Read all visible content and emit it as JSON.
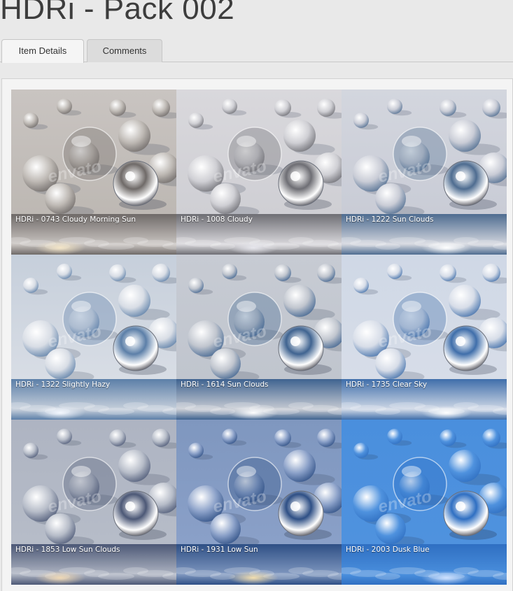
{
  "page": {
    "title": "HDRi - Pack 002"
  },
  "tabs": [
    {
      "label": "Item Details",
      "active": true
    },
    {
      "label": "Comments",
      "active": false
    }
  ],
  "preview": {
    "watermark": "envato",
    "tiles": [
      {
        "caption": "HDRi - 0743 Cloudy Morning Sun",
        "bg": "#c9c4c1",
        "floor": "#bdb8b3",
        "sky": "#6f6a68",
        "glow": "#f4e6c8"
      },
      {
        "caption": "HDRi - 1008 Cloudy",
        "bg": "#d9d8dc",
        "floor": "#cfcfd4",
        "sky": "#6e6e74",
        "glow": "#e8e8ee"
      },
      {
        "caption": "HDRi - 1222 Sun Clouds",
        "bg": "#d3d6de",
        "floor": "#c9ccd6",
        "sky": "#4e6c90",
        "glow": "#ffffff"
      },
      {
        "caption": "HDRi - 1322 Slightly Hazy",
        "bg": "#c6cfdb",
        "floor": "#d8dde5",
        "sky": "#5c7fa8",
        "glow": "#f4f8ff"
      },
      {
        "caption": "HDRi - 1614 Sun Clouds",
        "bg": "#c7cbd3",
        "floor": "#c0c5ce",
        "sky": "#3f6390",
        "glow": "#ffffff"
      },
      {
        "caption": "HDRi - 1735 Clear Sky",
        "bg": "#cfd8e6",
        "floor": "#d7dde8",
        "sky": "#3f6eaa",
        "glow": "#ffffff"
      },
      {
        "caption": "HDRi - 1853 Low Sun Clouds",
        "bg": "#aeb4c2",
        "floor": "#b6bcc8",
        "sky": "#4c5876",
        "glow": "#f0d9b6"
      },
      {
        "caption": "HDRi - 1931 Low Sun",
        "bg": "#7f97bf",
        "floor": "#8aa0c8",
        "sky": "#2e4f85",
        "glow": "#f6e1b0"
      },
      {
        "caption": "HDRi - 2003 Dusk Blue",
        "bg": "#4a8fdd",
        "floor": "#4f92de",
        "sky": "#2f6fc2",
        "glow": "#cfe2ff"
      }
    ]
  }
}
